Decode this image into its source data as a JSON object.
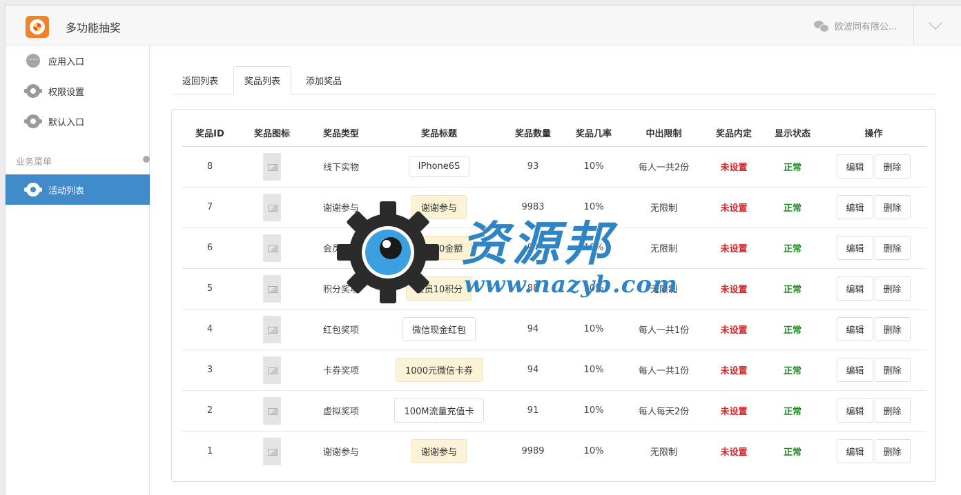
{
  "app": {
    "title": "多功能抽奖",
    "company": "欧波同有限公..."
  },
  "sidebar": {
    "items": [
      {
        "label": "应用入口",
        "icon": "chat-icon"
      },
      {
        "label": "权限设置",
        "icon": "gear-icon"
      },
      {
        "label": "默认入口",
        "icon": "gear-icon"
      }
    ],
    "section_label": "业务菜单",
    "active_item": {
      "label": "活动列表",
      "icon": "gear-icon"
    }
  },
  "tabs": [
    "返回列表",
    "奖品列表",
    "添加奖品"
  ],
  "active_tab": "奖品列表",
  "table": {
    "headers": [
      "奖品ID",
      "奖品图标",
      "奖品类型",
      "奖品标题",
      "奖品数量",
      "奖品几率",
      "中出限制",
      "奖品内定",
      "显示状态",
      "操作"
    ],
    "rows": [
      {
        "id": "8",
        "type": "线下实物",
        "title": "IPhone6S",
        "title_highlight": false,
        "qty": "93",
        "rate": "10%",
        "limit": "每人一共2份",
        "fixed": "未设置",
        "status": "正常"
      },
      {
        "id": "7",
        "type": "谢谢参与",
        "title": "谢谢参与",
        "title_highlight": true,
        "qty": "9983",
        "rate": "10%",
        "limit": "无限制",
        "fixed": "未设置",
        "status": "正常"
      },
      {
        "id": "6",
        "type": "会员奖项",
        "title": "会员10金额",
        "title_highlight": true,
        "qty": "94",
        "rate": "10%",
        "limit": "无限制",
        "fixed": "未设置",
        "status": "正常"
      },
      {
        "id": "5",
        "type": "积分奖项",
        "title": "会员10积分",
        "title_highlight": true,
        "qty": "88",
        "rate": "10%",
        "limit": "无限制",
        "fixed": "未设置",
        "status": "正常"
      },
      {
        "id": "4",
        "type": "红包奖项",
        "title": "微信现金红包",
        "title_highlight": false,
        "qty": "94",
        "rate": "10%",
        "limit": "每人一共1份",
        "fixed": "未设置",
        "status": "正常"
      },
      {
        "id": "3",
        "type": "卡券奖项",
        "title": "1000元微信卡券",
        "title_highlight": true,
        "qty": "94",
        "rate": "10%",
        "limit": "每人一共1份",
        "fixed": "未设置",
        "status": "正常"
      },
      {
        "id": "2",
        "type": "虚拟奖项",
        "title": "100M流量充值卡",
        "title_highlight": false,
        "qty": "91",
        "rate": "10%",
        "limit": "每人每天2份",
        "fixed": "未设置",
        "status": "正常"
      },
      {
        "id": "1",
        "type": "谢谢参与",
        "title": "谢谢参与",
        "title_highlight": true,
        "qty": "9989",
        "rate": "10%",
        "limit": "无限制",
        "fixed": "未设置",
        "status": "正常"
      }
    ],
    "edit_label": "编辑",
    "delete_label": "删除"
  },
  "watermark": {
    "text": "资源邦",
    "url": "www.nazyb.com"
  },
  "colors": {
    "accent": "#428bca",
    "danger": "#d9262a",
    "success": "#1e8a1e",
    "highlight": "#fcf3d6"
  }
}
